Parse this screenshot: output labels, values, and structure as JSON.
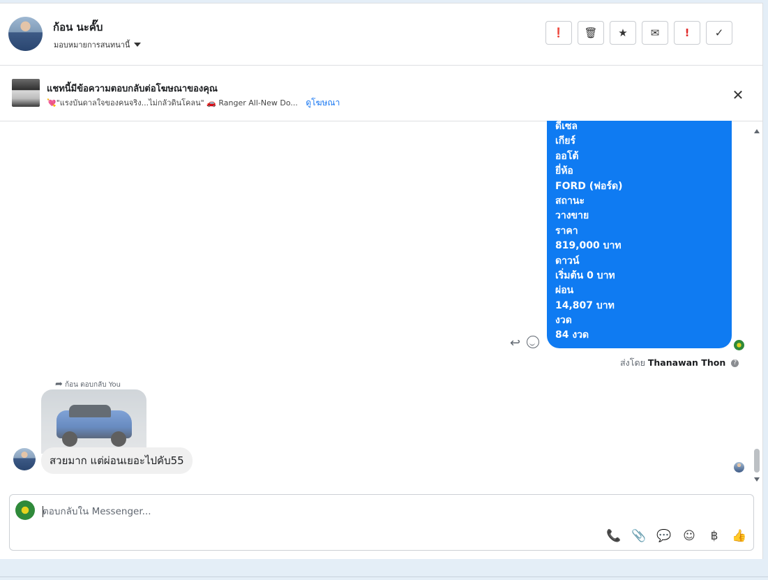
{
  "header": {
    "contact_name": "ก้อน นะคั๊บ",
    "assign_label": "มอบหมายการสนทนานี้",
    "toolbar": [
      {
        "icon": "alert-circle-icon",
        "glyph": "❗"
      },
      {
        "icon": "trash-icon",
        "glyph": "🗑"
      },
      {
        "icon": "star-icon",
        "glyph": "★"
      },
      {
        "icon": "envelope-icon",
        "glyph": "✉"
      },
      {
        "icon": "exclamation-icon",
        "glyph": "!"
      },
      {
        "icon": "check-icon",
        "glyph": "✓"
      }
    ]
  },
  "ad_banner": {
    "title": "แชทนี้มีข้อความตอบกลับต่อโฆษณาของคุณ",
    "snippet": "💘\"แรงบันดาลใจของคนจริง...ไม่กลัวดินโคลน\" 🚗 Ranger All-New Do...",
    "link_label": "ดูโฆษณา",
    "close_glyph": "✕"
  },
  "messages": {
    "outgoing_lines": [
      "ดีเซล",
      "เกียร์",
      "ออโต้",
      "ยี่ห้อ",
      "FORD (ฟอร์ด)",
      "สถานะ",
      "วางขาย",
      "ราคา",
      "819,000 บาท",
      "ดาวน์",
      "เริ่มต้น 0 บาท",
      "ผ่อน",
      "14,807 บาท",
      "งวด",
      "84 งวด"
    ],
    "sent_by_prefix": "ส่งโดย",
    "sent_by_name": "Thanawan Thon",
    "reply_note": "ก้อน ตอบกลับ You",
    "incoming_text": "สวยมาก แต่ผ่อนเยอะไปคับ55"
  },
  "composer": {
    "placeholder": "ตอบกลับใน Messenger...",
    "icons": [
      {
        "name": "call-add-icon",
        "glyph": "📞"
      },
      {
        "name": "attachment-icon",
        "glyph": "📎"
      },
      {
        "name": "saved-reply-icon",
        "glyph": "💬"
      },
      {
        "name": "emoji-icon",
        "glyph": "☺"
      },
      {
        "name": "currency-baht-icon",
        "glyph": "฿"
      },
      {
        "name": "like-icon",
        "glyph": "👍"
      }
    ]
  },
  "colors": {
    "outgoing_bubble": "#0f7bf2",
    "incoming_bubble": "#f0f0f0",
    "link": "#1877f2",
    "accent_red": "#e02a2a"
  }
}
